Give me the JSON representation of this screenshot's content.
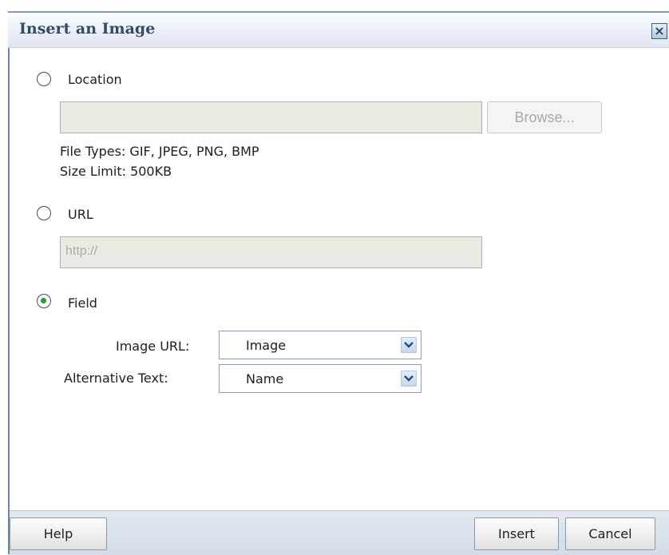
{
  "dialog": {
    "title": "Insert an Image",
    "close_label": "×"
  },
  "location": {
    "label": "Location",
    "selected": false,
    "input_value": "",
    "browse_label": "Browse...",
    "file_types": "File Types: GIF, JPEG, PNG, BMP",
    "size_limit": "Size Limit: 500KB"
  },
  "url": {
    "label": "URL",
    "selected": false,
    "input_value": "http://"
  },
  "field": {
    "label": "Field",
    "selected": true,
    "image_url_label": "Image URL:",
    "image_url_value": "Image",
    "alt_text_label": "Alternative Text:",
    "alt_text_value": "Name"
  },
  "footer": {
    "help_label": "Help",
    "insert_label": "Insert",
    "cancel_label": "Cancel"
  },
  "icons": {
    "close": "close-icon",
    "dropdown": "chevron-down-icon"
  }
}
